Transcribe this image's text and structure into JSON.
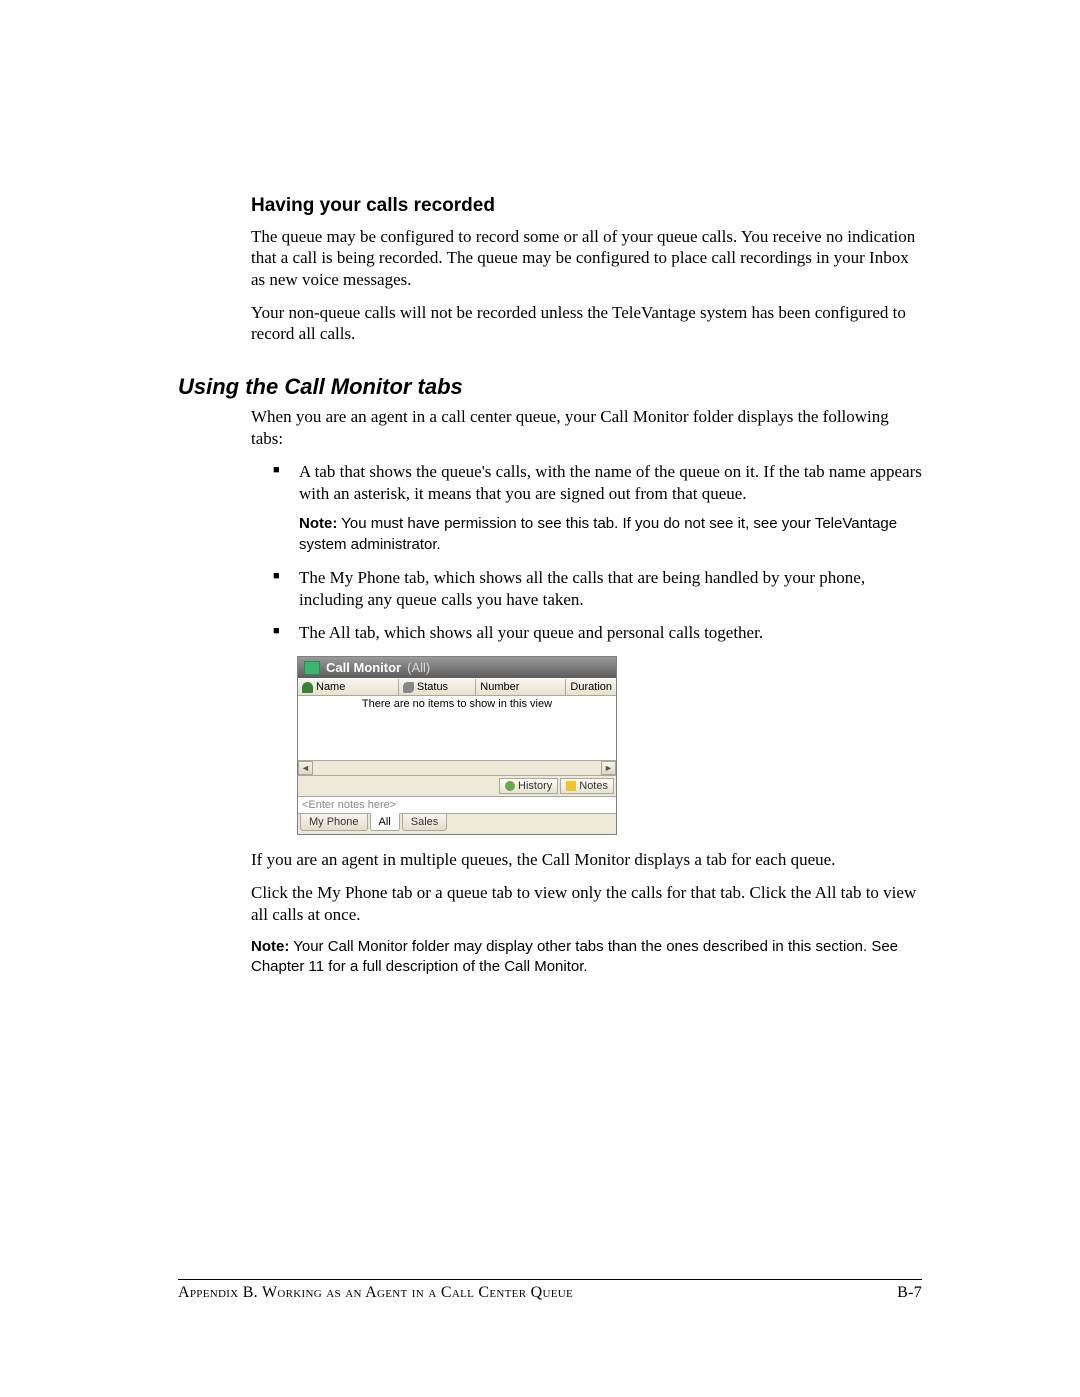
{
  "section1": {
    "heading": "Having your calls recorded",
    "p1": "The queue may be configured to record some or all of your queue calls. You receive no indication that a call is being recorded. The queue may be configured to place call recordings in your Inbox as new voice messages.",
    "p2": "Your non-queue calls will not be recorded unless the TeleVantage system has been configured to record all calls."
  },
  "section2": {
    "heading": "Using the Call Monitor tabs",
    "intro": "When you are an agent in a call center queue, your Call Monitor folder displays the following tabs:",
    "bullets": {
      "b1": "A tab that shows the queue's calls, with the name of the queue on it. If the tab name appears with an asterisk, it means that you are signed out from that queue.",
      "b1_note_label": "Note:",
      "b1_note_text": "  You must have permission to see this tab. If you do not see it, see your TeleVantage system administrator.",
      "b2": "The My Phone tab, which shows all the calls that are being handled by your phone, including any queue calls you have taken.",
      "b3": "The All tab, which shows all your queue and personal calls together."
    },
    "after_img_p1": "If you are an agent in multiple queues, the Call Monitor displays a tab for each queue.",
    "after_img_p2": "Click the My Phone tab or a queue tab to view only the calls for that tab. Click the All tab to view all calls at once.",
    "final_note_label": "Note:",
    "final_note_text": "  Your Call Monitor folder may display other tabs than the ones described in this section. See Chapter 11 for a full description of the Call Monitor."
  },
  "app": {
    "title_main": "Call Monitor",
    "title_sub": "(All)",
    "columns": {
      "name": "Name",
      "status": "Status",
      "number": "Number",
      "duration": "Duration"
    },
    "empty_msg": "There are no items to show in this view",
    "history_btn": "History",
    "notes_btn": "Notes",
    "notes_placeholder": "<Enter notes here>",
    "tabs": {
      "my_phone": "My Phone",
      "all": "All",
      "sales": "Sales"
    }
  },
  "footer": {
    "left": "Appendix B. Working as an Agent in a Call Center Queue",
    "right": "B-7"
  }
}
